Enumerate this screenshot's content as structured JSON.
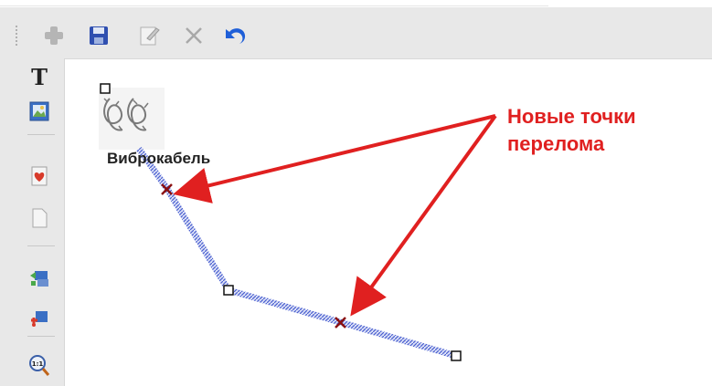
{
  "toolbar": {
    "buttons": [
      {
        "name": "add-icon"
      },
      {
        "name": "save-icon"
      },
      {
        "name": "edit-icon"
      },
      {
        "name": "delete-icon"
      },
      {
        "name": "undo-icon"
      }
    ]
  },
  "sidebar": {
    "tools": [
      {
        "name": "text-tool-icon",
        "glyph": "T"
      },
      {
        "name": "image-tool-icon"
      },
      {
        "name": "favorite-icon"
      },
      {
        "name": "blank-page-icon"
      },
      {
        "name": "network-icon"
      },
      {
        "name": "remove-link-icon"
      },
      {
        "name": "zoom-1-1-icon",
        "glyph": "1:1"
      }
    ]
  },
  "diagram": {
    "device_label": "Виброкабель",
    "cable_color": "#4a5fd0",
    "new_point_color": "#8b1010"
  },
  "annotation": {
    "line1": "Новые точки",
    "line2": "перелома",
    "color": "#e02020"
  }
}
